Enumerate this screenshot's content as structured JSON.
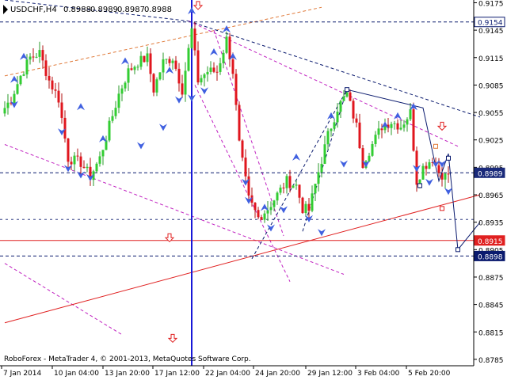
{
  "colors": {
    "background": "#ffffff",
    "bull": "#32cd32",
    "bear": "#e0161e",
    "wick_bull": "#2a9a2a",
    "wick_bear": "#b01010",
    "grid": "#000000",
    "navy": "#0a1a6e",
    "magenta": "#c020c0",
    "red": "#e02020",
    "blue_line": "#1818d8",
    "orange_line": "#e07a3a",
    "marker": "#4060e0",
    "current_label_bg": "#1a2a7a",
    "red_label_bg": "#e02020",
    "text": "#000000"
  },
  "chart_data": {
    "type": "candlestick",
    "header": {
      "symbol": "USDCHF,H4",
      "ohlc": [
        "0.8988",
        "0.8989",
        "0.8987",
        "0.8988"
      ]
    },
    "watermark": "RoboForex - MetaTrader 4, © 2001-2013, MetaQuotes Software Corp.",
    "y_axis": {
      "range": [
        0.8778,
        0.9178
      ],
      "ticks": [
        "0.9175",
        "0.9145",
        "0.9115",
        "0.9085",
        "0.9055",
        "0.9025",
        "0.8995",
        "0.8965",
        "0.8935",
        "0.8905",
        "0.8875",
        "0.8845",
        "0.8815",
        "0.8785"
      ]
    },
    "x_axis": {
      "labels": [
        "7 Jan 2014",
        "10 Jan 04:00",
        "13 Jan 20:00",
        "17 Jan 12:00",
        "22 Jan 04:00",
        "24 Jan 20:00",
        "29 Jan 12:00",
        "3 Feb 04:00",
        "5 Feb 20:00"
      ]
    },
    "price_labels": [
      {
        "text": "0.9154",
        "value": 0.9154,
        "style": "navy_outline"
      },
      {
        "text": "0.8989",
        "value": 0.8989,
        "style": "current"
      },
      {
        "text": "0.8915",
        "value": 0.8915,
        "style": "red"
      },
      {
        "text": "0.8898",
        "value": 0.8898,
        "style": "navy"
      }
    ],
    "horizontal_lines": [
      {
        "value": 0.9154,
        "style": "navy_dashed"
      },
      {
        "value": 0.8989,
        "style": "navy_dashed"
      },
      {
        "value": 0.8938,
        "style": "navy_dashed_thin"
      },
      {
        "value": 0.8915,
        "style": "red_solid"
      },
      {
        "value": 0.8898,
        "style": "navy_dashed"
      }
    ],
    "vertical_line_bar": 59,
    "price_anchors": [
      {
        "bar": 0,
        "price": 0.906
      },
      {
        "bar": 2,
        "price": 0.907
      },
      {
        "bar": 5,
        "price": 0.9095
      },
      {
        "bar": 8,
        "price": 0.9115
      },
      {
        "bar": 11,
        "price": 0.912
      },
      {
        "bar": 14,
        "price": 0.909
      },
      {
        "bar": 17,
        "price": 0.907
      },
      {
        "bar": 20,
        "price": 0.9005
      },
      {
        "bar": 24,
        "price": 0.9
      },
      {
        "bar": 27,
        "price": 0.8985
      },
      {
        "bar": 30,
        "price": 0.9005
      },
      {
        "bar": 33,
        "price": 0.904
      },
      {
        "bar": 36,
        "price": 0.9075
      },
      {
        "bar": 39,
        "price": 0.91
      },
      {
        "bar": 42,
        "price": 0.911
      },
      {
        "bar": 45,
        "price": 0.9115
      },
      {
        "bar": 47,
        "price": 0.908
      },
      {
        "bar": 50,
        "price": 0.911
      },
      {
        "bar": 53,
        "price": 0.9115
      },
      {
        "bar": 56,
        "price": 0.908
      },
      {
        "bar": 59,
        "price": 0.9145
      },
      {
        "bar": 61,
        "price": 0.909
      },
      {
        "bar": 64,
        "price": 0.91
      },
      {
        "bar": 67,
        "price": 0.91
      },
      {
        "bar": 70,
        "price": 0.9135
      },
      {
        "bar": 72,
        "price": 0.91
      },
      {
        "bar": 74,
        "price": 0.902
      },
      {
        "bar": 77,
        "price": 0.896
      },
      {
        "bar": 80,
        "price": 0.894
      },
      {
        "bar": 83,
        "price": 0.895
      },
      {
        "bar": 86,
        "price": 0.8965
      },
      {
        "bar": 89,
        "price": 0.898
      },
      {
        "bar": 92,
        "price": 0.8975
      },
      {
        "bar": 94,
        "price": 0.895
      },
      {
        "bar": 96,
        "price": 0.8948
      },
      {
        "bar": 99,
        "price": 0.899
      },
      {
        "bar": 102,
        "price": 0.903
      },
      {
        "bar": 105,
        "price": 0.906
      },
      {
        "bar": 108,
        "price": 0.9075
      },
      {
        "bar": 111,
        "price": 0.904
      },
      {
        "bar": 113,
        "price": 0.9
      },
      {
        "bar": 116,
        "price": 0.902
      },
      {
        "bar": 119,
        "price": 0.904
      },
      {
        "bar": 122,
        "price": 0.9045
      },
      {
        "bar": 125,
        "price": 0.904
      },
      {
        "bar": 128,
        "price": 0.9055
      },
      {
        "bar": 130,
        "price": 0.898
      },
      {
        "bar": 132,
        "price": 0.8995
      },
      {
        "bar": 135,
        "price": 0.9005
      },
      {
        "bar": 137,
        "price": 0.899
      },
      {
        "bar": 139,
        "price": 0.8985
      },
      {
        "bar": 140,
        "price": 0.8988
      }
    ],
    "trendlines": [
      {
        "style": "orange_dashed",
        "from": {
          "bar": 0,
          "price": 0.9095
        },
        "to": {
          "bar": 100,
          "price": 0.917
        }
      },
      {
        "style": "navy_dashed",
        "from": {
          "bar": 0,
          "price": 0.9178
        },
        "to": {
          "bar": 58,
          "price": 0.9155
        }
      },
      {
        "style": "navy_dashed",
        "from": {
          "bar": 58,
          "price": 0.9155
        },
        "to": {
          "bar": 150,
          "price": 0.905
        }
      },
      {
        "style": "magenta_dashed",
        "from": {
          "bar": 58,
          "price": 0.9155
        },
        "to": {
          "bar": 143,
          "price": 0.9018
        }
      },
      {
        "style": "magenta_dashed",
        "from": {
          "bar": 0,
          "price": 0.902
        },
        "to": {
          "bar": 107,
          "price": 0.8878
        }
      },
      {
        "style": "magenta_dashed",
        "from": {
          "bar": 0,
          "price": 0.889
        },
        "to": {
          "bar": 37,
          "price": 0.8812
        }
      },
      {
        "style": "magenta_dashed",
        "from": {
          "bar": 60,
          "price": 0.9085
        },
        "to": {
          "bar": 90,
          "price": 0.887
        }
      },
      {
        "style": "magenta_dashed",
        "from": {
          "bar": 66,
          "price": 0.9145
        },
        "to": {
          "bar": 88,
          "price": 0.892
        }
      },
      {
        "style": "red_solid",
        "from": {
          "bar": 0,
          "price": 0.8825
        },
        "to": {
          "bar": 150,
          "price": 0.8965
        }
      },
      {
        "style": "navy_dashed",
        "from": {
          "bar": 78,
          "price": 0.8895
        },
        "to": {
          "bar": 108,
          "price": 0.908
        }
      },
      {
        "style": "navy_dashed",
        "from": {
          "bar": 94,
          "price": 0.8925
        },
        "to": {
          "bar": 108,
          "price": 0.908
        }
      }
    ],
    "projection_path": [
      {
        "bar": 108,
        "price": 0.908
      },
      {
        "bar": 132,
        "price": 0.906
      },
      {
        "bar": 137,
        "price": 0.898
      },
      {
        "bar": 140,
        "price": 0.901
      },
      {
        "bar": 143,
        "price": 0.8905
      },
      {
        "bar": 150,
        "price": 0.8935
      }
    ],
    "wave_boxes": [
      {
        "bar": 108,
        "price": 0.908,
        "color": "navy"
      },
      {
        "bar": 131,
        "price": 0.8975,
        "color": "navy"
      },
      {
        "bar": 136,
        "price": 0.9018,
        "color": "orange"
      },
      {
        "bar": 138,
        "price": 0.895,
        "color": "red"
      },
      {
        "bar": 140,
        "price": 0.9005,
        "color": "navy"
      },
      {
        "bar": 143,
        "price": 0.8905,
        "color": "navy"
      }
    ],
    "fractal_markers": [
      {
        "bar": 3,
        "price": 0.909,
        "dir": "up"
      },
      {
        "bar": 6,
        "price": 0.9115,
        "dir": "up"
      },
      {
        "bar": 3,
        "price": 0.9065,
        "dir": "down"
      },
      {
        "bar": 18,
        "price": 0.9035,
        "dir": "down"
      },
      {
        "bar": 20,
        "price": 0.8995,
        "dir": "down"
      },
      {
        "bar": 24,
        "price": 0.8988,
        "dir": "down"
      },
      {
        "bar": 27,
        "price": 0.8985,
        "dir": "down"
      },
      {
        "bar": 24,
        "price": 0.906,
        "dir": "up"
      },
      {
        "bar": 31,
        "price": 0.9025,
        "dir": "up"
      },
      {
        "bar": 38,
        "price": 0.911,
        "dir": "up"
      },
      {
        "bar": 43,
        "price": 0.902,
        "dir": "down"
      },
      {
        "bar": 50,
        "price": 0.904,
        "dir": "down"
      },
      {
        "bar": 52,
        "price": 0.91,
        "dir": "up"
      },
      {
        "bar": 55,
        "price": 0.907,
        "dir": "down"
      },
      {
        "bar": 59,
        "price": 0.9165,
        "dir": "up"
      },
      {
        "bar": 59,
        "price": 0.9072,
        "dir": "down"
      },
      {
        "bar": 63,
        "price": 0.908,
        "dir": "down"
      },
      {
        "bar": 66,
        "price": 0.912,
        "dir": "up"
      },
      {
        "bar": 70,
        "price": 0.9145,
        "dir": "up"
      },
      {
        "bar": 72,
        "price": 0.9115,
        "dir": "up"
      },
      {
        "bar": 76,
        "price": 0.898,
        "dir": "down"
      },
      {
        "bar": 77,
        "price": 0.896,
        "dir": "down"
      },
      {
        "bar": 82,
        "price": 0.895,
        "dir": "up"
      },
      {
        "bar": 84,
        "price": 0.893,
        "dir": "down"
      },
      {
        "bar": 88,
        "price": 0.895,
        "dir": "down"
      },
      {
        "bar": 92,
        "price": 0.9005,
        "dir": "up"
      },
      {
        "bar": 96,
        "price": 0.894,
        "dir": "down"
      },
      {
        "bar": 100,
        "price": 0.8925,
        "dir": "down"
      },
      {
        "bar": 103,
        "price": 0.905,
        "dir": "up"
      },
      {
        "bar": 107,
        "price": 0.9,
        "dir": "down"
      },
      {
        "bar": 114,
        "price": 0.9,
        "dir": "down"
      },
      {
        "bar": 120,
        "price": 0.904,
        "dir": "up"
      },
      {
        "bar": 124,
        "price": 0.905,
        "dir": "up"
      },
      {
        "bar": 129,
        "price": 0.906,
        "dir": "up"
      },
      {
        "bar": 130,
        "price": 0.8995,
        "dir": "down"
      },
      {
        "bar": 134,
        "price": 0.898,
        "dir": "down"
      },
      {
        "bar": 136,
        "price": 0.9,
        "dir": "down"
      },
      {
        "bar": 138,
        "price": 0.9,
        "dir": "down"
      },
      {
        "bar": 140,
        "price": 0.897,
        "dir": "down"
      }
    ],
    "hollow_arrows": [
      {
        "bar": 61,
        "price": 0.9172,
        "dir": "down"
      },
      {
        "bar": 52,
        "price": 0.8918,
        "dir": "down"
      },
      {
        "bar": 53,
        "price": 0.8808,
        "dir": "down"
      },
      {
        "bar": 138,
        "price": 0.904,
        "dir": "down"
      }
    ]
  }
}
